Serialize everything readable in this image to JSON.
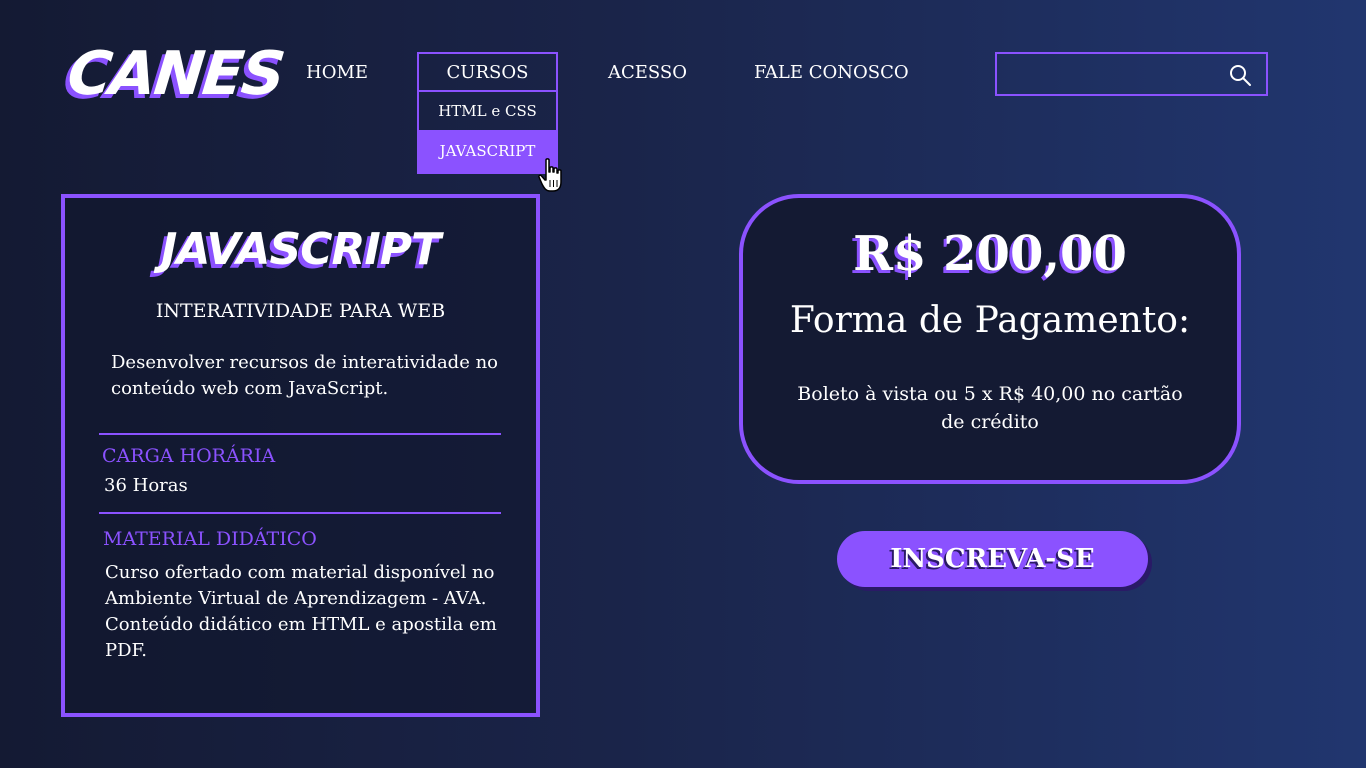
{
  "brand": {
    "logo_text": "CANES"
  },
  "nav": {
    "home": "HOME",
    "cursos": "CURSOS",
    "acesso": "ACESSO",
    "fale_conosco": "FALE CONOSCO",
    "cursos_menu": [
      {
        "label": "HTML e CSS",
        "active": false
      },
      {
        "label": "JAVASCRIPT",
        "active": true
      }
    ]
  },
  "search": {
    "value": "",
    "placeholder": "",
    "icon": "search-icon"
  },
  "course": {
    "title": "JAVASCRIPT",
    "subtitle": "INTERATIVIDADE PARA WEB",
    "description": "Desenvolver recursos de interatividade no conteúdo web com JavaScript.",
    "workload_label": "CARGA HORÁRIA",
    "workload_value": "36 Horas",
    "material_label": "MATERIAL DIDÁTICO",
    "material_value": "Curso ofertado com material disponível no Ambiente Virtual de Aprendizagem - AVA. Conteúdo didático em HTML e apostila em PDF."
  },
  "pricing": {
    "price": "R$ 200,00",
    "payment_title": "Forma de Pagamento:",
    "payment_desc": "Boleto à vista ou 5 x R$ 40,00 no cartão de crédito"
  },
  "cta": {
    "label": "INSCREVA-SE"
  },
  "colors": {
    "accent": "#8b52ff",
    "background_start": "#141a33",
    "background_end": "#21366f",
    "text": "#ffffff"
  }
}
